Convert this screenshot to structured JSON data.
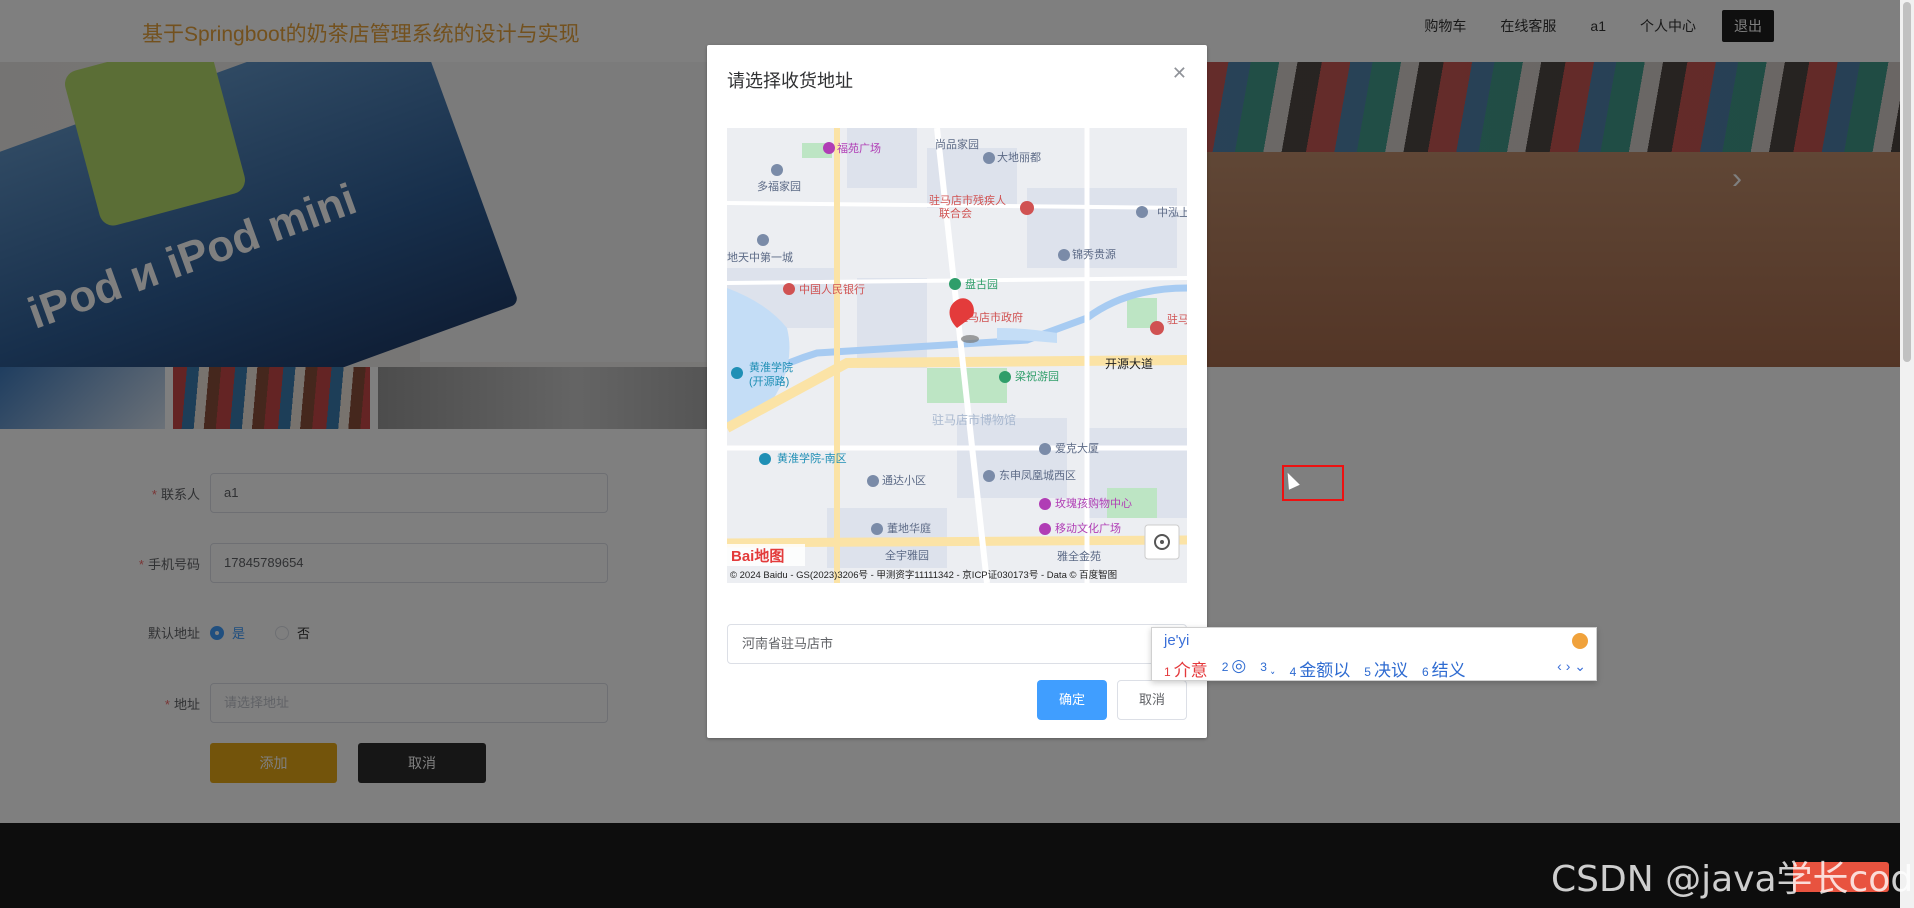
{
  "header": {
    "site_title": "基于Springboot的奶茶店管理系统的设计与实现",
    "nav": [
      "购物车",
      "在线客服",
      "a1",
      "个人中心"
    ],
    "logout": "退出"
  },
  "banner": {
    "image_text": "iPod и iPod mini",
    "next_icon": "chevron-right-icon"
  },
  "form": {
    "contact": {
      "label": "联系人",
      "value": "a1"
    },
    "phone": {
      "label": "手机号码",
      "value": "17845789654"
    },
    "default_address": {
      "label": "默认地址",
      "options": [
        "是",
        "否"
      ],
      "selected": "是"
    },
    "address": {
      "label": "地址",
      "placeholder": "请选择地址"
    },
    "add_button": "添加",
    "cancel_button": "取消"
  },
  "dialog": {
    "title": "请选择收货地址",
    "close_icon": "close-icon",
    "map": {
      "labels": {
        "fuyuan": "福苑广场",
        "shangpin": "尚品家园",
        "dadi": "大地丽都",
        "duofu": "多福家园",
        "canjiren": "驻马店市残疾人",
        "lianhehui": "联合会",
        "zhongshang": "中泓上",
        "jinxiu": "锦秀贵源",
        "tianzhong": "地天中第一城",
        "bank": "中国人民银行",
        "pangu": "盘古园",
        "gov": "驻马店市政府",
        "qingshao": "驻马青少",
        "huanghuai": "黄淮学院",
        "kaiyuanlu": "(开源路)",
        "kaiyuan": "开源大道",
        "liangzhu": "梁祝游园",
        "museum": "驻马店市博物馆",
        "huanghuai_south": "黄淮学院-南区",
        "aike": "爱克大厦",
        "tongda": "通达小区",
        "dongshen": "东申凤凰城西区",
        "meigui": "玫瑰孩购物中心",
        "huadi": "董地华庭",
        "wenhua": "移动文化广场",
        "quanyu": "全宇雅园",
        "jinyuan": "雅全金苑"
      },
      "copyright": "© 2024 Baidu - GS(2023)3206号 - 甲测资字11111342 - 京ICP证030173号 - Data © 百度智图",
      "logo": "Bai地图"
    },
    "address_value": "河南省驻马店市",
    "confirm": "确定",
    "cancel": "取消"
  },
  "ime": {
    "pinyin": "je'yi",
    "candidates": [
      {
        "n": "1",
        "text": "介意"
      },
      {
        "n": "2",
        "text": ""
      },
      {
        "n": "3",
        "text": ""
      },
      {
        "n": "4",
        "text": "金额以"
      },
      {
        "n": "5",
        "text": "决议"
      },
      {
        "n": "6",
        "text": "结义"
      }
    ],
    "nav": "‹ › ⌄"
  },
  "watermark": "CSDN @java学长code"
}
